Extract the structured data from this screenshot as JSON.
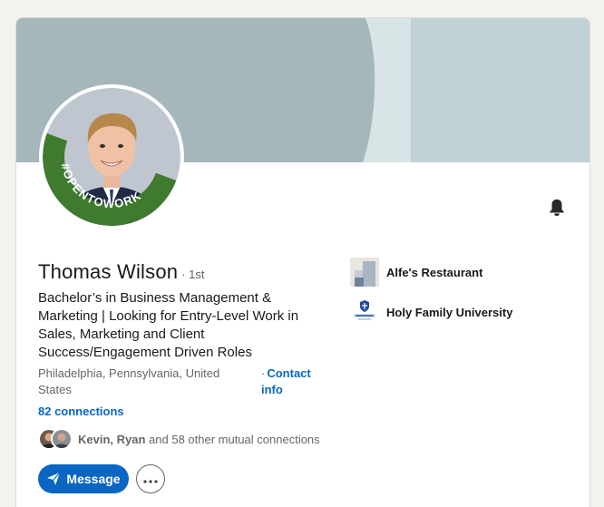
{
  "profile": {
    "name": "Thomas Wilson",
    "degree": "· 1st",
    "badge": "#OPENTOWORK",
    "headline": "Bachelor’s in Business Management & Marketing | Looking for Entry-Level Work in Sales, Marketing and Client Success/Engagement Driven Roles",
    "location": "Philadelphia, Pennsylvania, United States",
    "contact_dot": "·",
    "contact_info": "Contact info",
    "connections": "82 connections",
    "mutual": {
      "names": "Kevin, Ryan",
      "rest": " and 58 other mutual connections"
    }
  },
  "actions": {
    "message_label": "Message"
  },
  "experience": [
    {
      "name": "Alfe's Restaurant",
      "logo": "building-logo-icon"
    },
    {
      "name": "Holy Family University",
      "logo": "holy-family-logo-icon",
      "logo_text": "Holy Family"
    }
  ],
  "colors": {
    "banner_left": "#a5b7ba",
    "banner_right": "#c0d2d5",
    "open_to_work_green": "#3f7a2e",
    "primary_blue": "#0a66c2"
  },
  "icons": {
    "bell": "bell-icon",
    "send": "send-icon",
    "more": "ellipsis-icon"
  }
}
